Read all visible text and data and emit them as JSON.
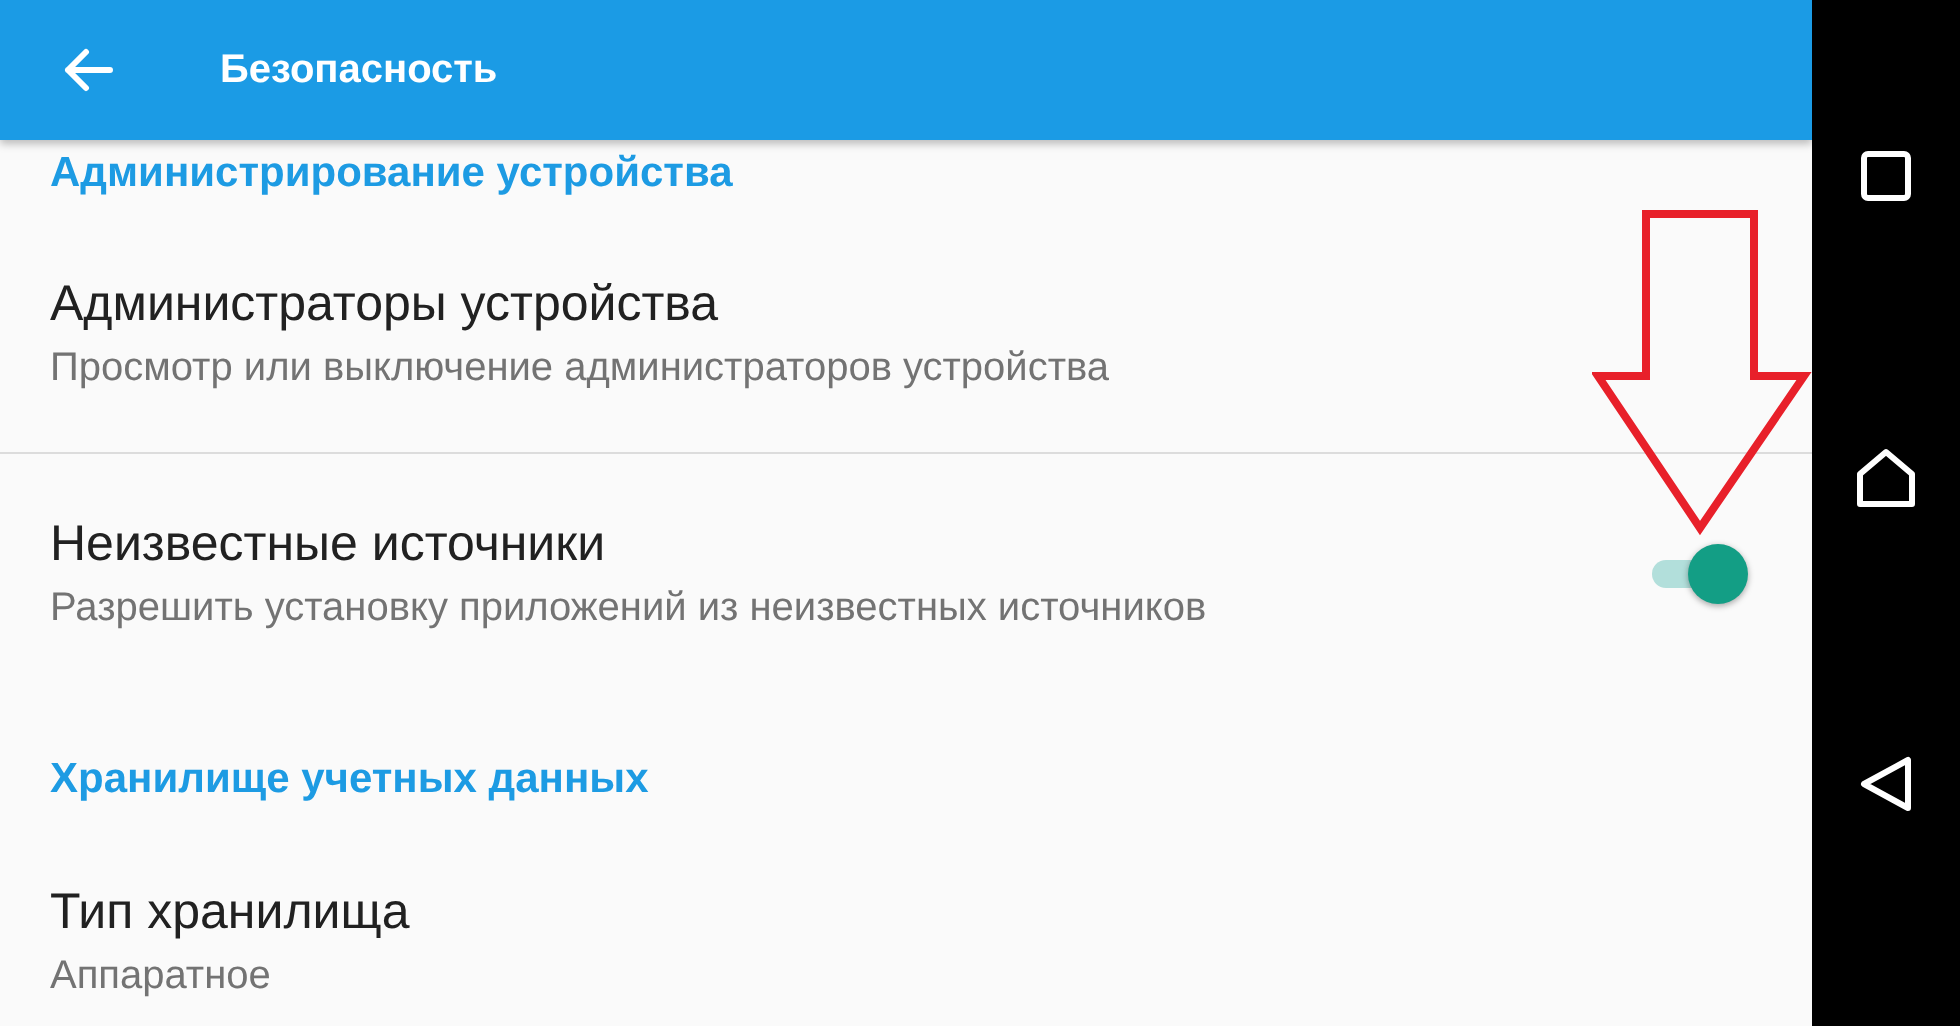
{
  "app_bar": {
    "title": "Безопасность"
  },
  "list": [
    {
      "kind": "header",
      "text": "Администрирование устройства"
    },
    {
      "kind": "item",
      "title": "Администраторы устройства",
      "subtitle": "Просмотр или выключение администраторов устройства",
      "divider_after": true
    },
    {
      "kind": "switch",
      "title": "Неизвестные источники",
      "subtitle": "Разрешить установку приложений из неизвестных источников",
      "on": true,
      "divider_after": false
    },
    {
      "kind": "header",
      "text": "Хранилище учетных данных"
    },
    {
      "kind": "item",
      "title": "Тип хранилища",
      "subtitle": "Аппаратное",
      "divider_after": false
    }
  ]
}
